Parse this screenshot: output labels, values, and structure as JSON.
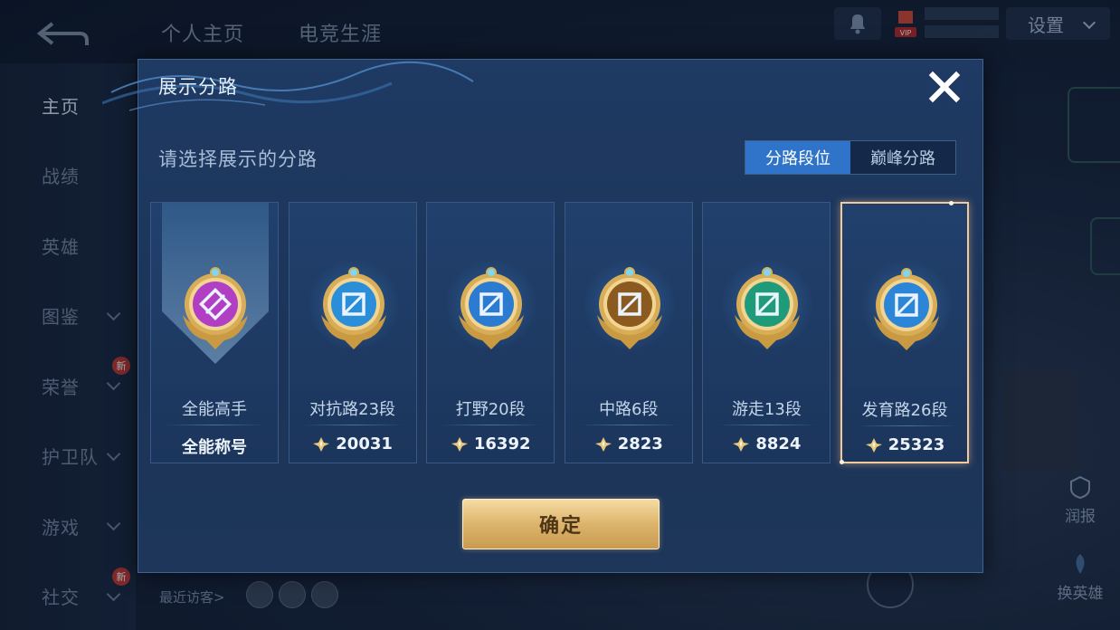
{
  "background": {
    "tabs": [
      "个人主页",
      "电竞生涯"
    ],
    "sidebar": [
      {
        "label": "主页",
        "active": true,
        "chevron": false,
        "badge": ""
      },
      {
        "label": "战绩",
        "active": false,
        "chevron": false,
        "badge": ""
      },
      {
        "label": "英雄",
        "active": false,
        "chevron": false,
        "badge": ""
      },
      {
        "label": "图鉴",
        "active": false,
        "chevron": true,
        "badge": ""
      },
      {
        "label": "荣誉",
        "active": false,
        "chevron": true,
        "badge": "新"
      },
      {
        "label": "护卫队",
        "active": false,
        "chevron": true,
        "badge": ""
      },
      {
        "label": "游戏",
        "active": false,
        "chevron": true,
        "badge": ""
      },
      {
        "label": "社交",
        "active": false,
        "chevron": true,
        "badge": "新"
      }
    ],
    "settings_label": "设置",
    "vip_label": "VIP",
    "recent_visitors_label": "最近访客>",
    "report_label": "润报",
    "swap_hero_label": "换英雄"
  },
  "modal": {
    "title": "展示分路",
    "subtitle": "请选择展示的分路",
    "segment_tabs": [
      {
        "label": "分路段位",
        "active": true
      },
      {
        "label": "巅峰分路",
        "active": false
      }
    ],
    "cards": [
      {
        "role": "全能高手",
        "bottom_label": "全能称号",
        "score": "",
        "emblem": "all-round-emblem-icon",
        "color": "#b03fc4",
        "banner": true,
        "selected": false
      },
      {
        "role": "对抗路23段",
        "bottom_label": "",
        "score": "20031",
        "emblem": "clash-lane-emblem-icon",
        "color": "#2a8fd8",
        "banner": false,
        "selected": false
      },
      {
        "role": "打野20段",
        "bottom_label": "",
        "score": "16392",
        "emblem": "jungle-emblem-icon",
        "color": "#2b7bd0",
        "banner": false,
        "selected": false
      },
      {
        "role": "中路6段",
        "bottom_label": "",
        "score": "2823",
        "emblem": "mid-lane-emblem-icon",
        "color": "#8a5a1e",
        "banner": false,
        "selected": false
      },
      {
        "role": "游走13段",
        "bottom_label": "",
        "score": "8824",
        "emblem": "roam-emblem-icon",
        "color": "#1f9b7a",
        "banner": false,
        "selected": false
      },
      {
        "role": "发育路26段",
        "bottom_label": "",
        "score": "25323",
        "emblem": "farm-lane-emblem-icon",
        "color": "#2b86d8",
        "banner": false,
        "selected": true
      }
    ],
    "confirm_label": "确定"
  }
}
